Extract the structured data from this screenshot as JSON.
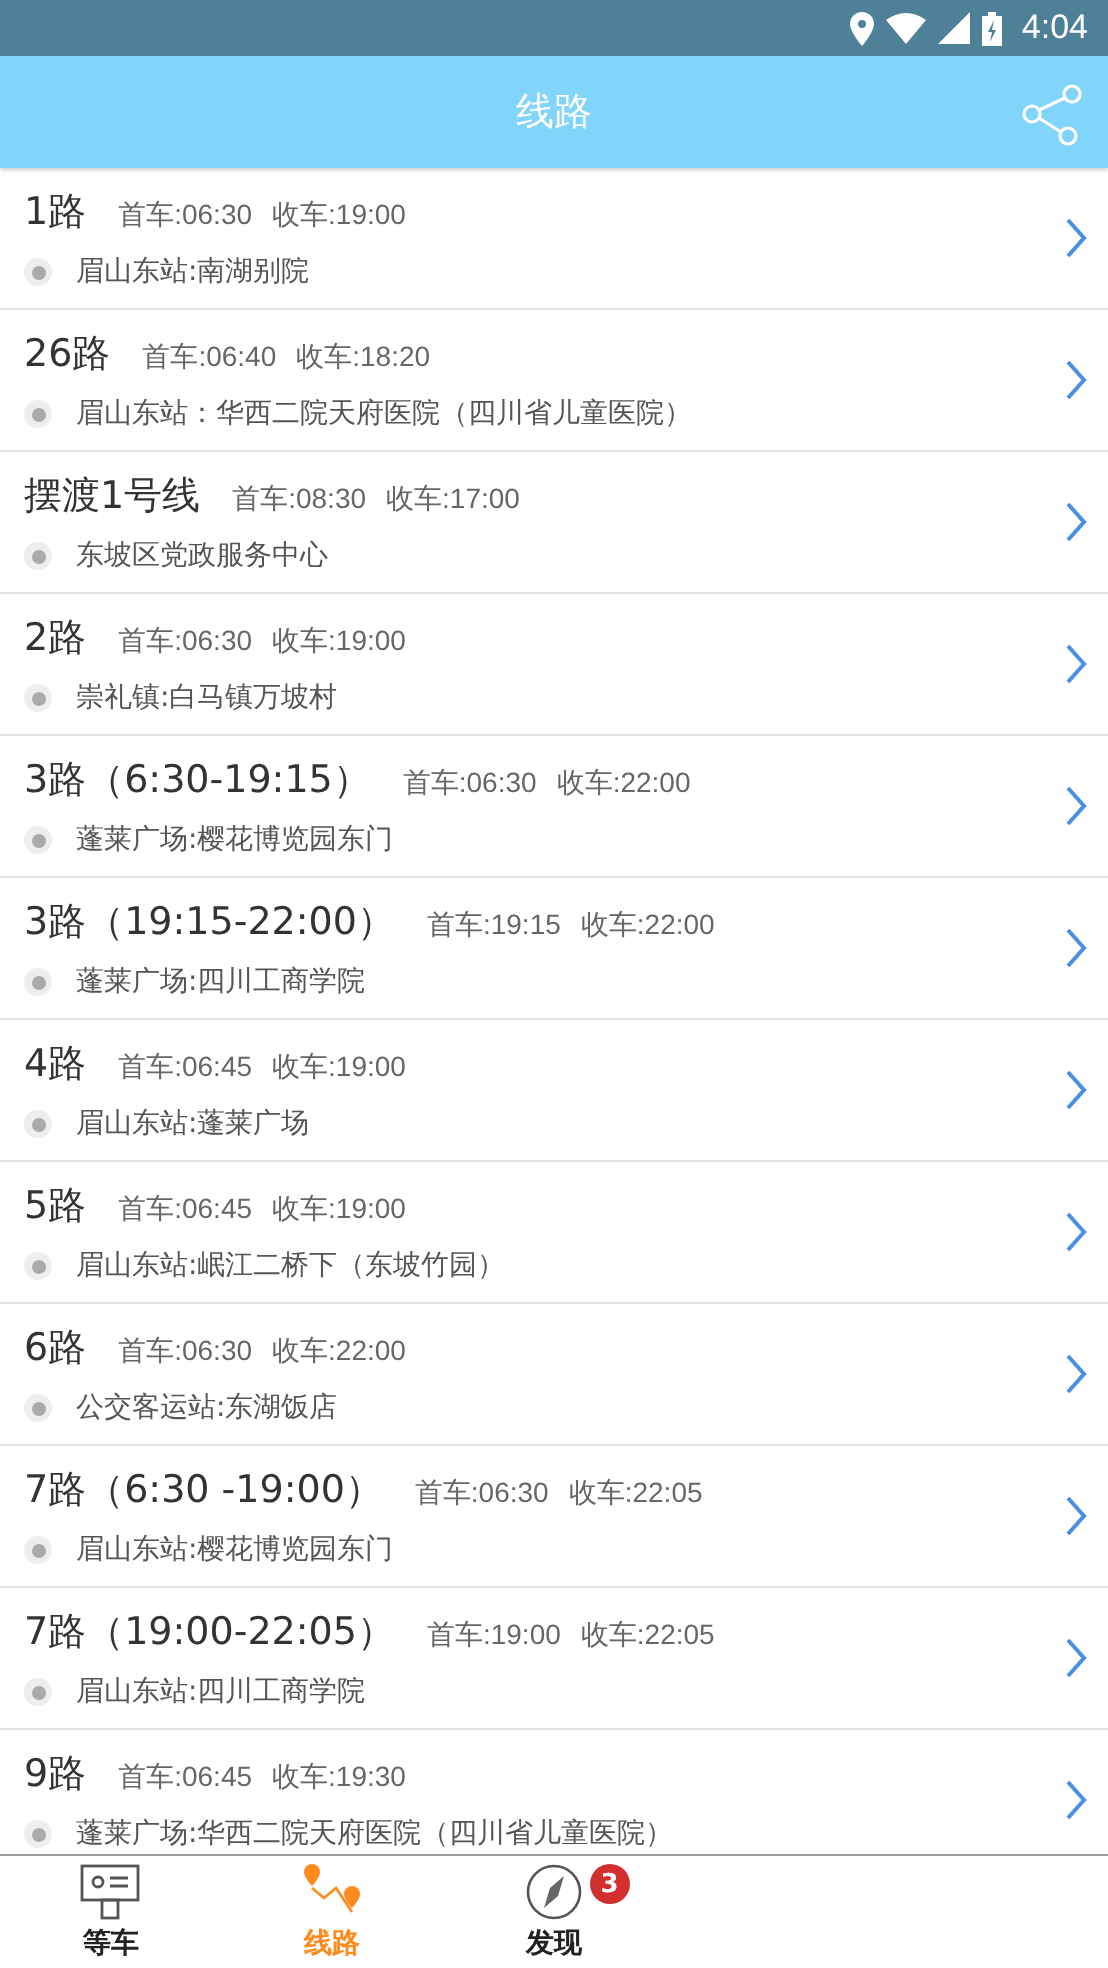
{
  "status_bar": {
    "time": "4:04"
  },
  "app_bar": {
    "title": "线路"
  },
  "routes": [
    {
      "name": "1路",
      "first": "首车:06:30",
      "last": "收车:19:00",
      "station": "眉山东站:南湖别院"
    },
    {
      "name": "26路",
      "first": "首车:06:40",
      "last": "收车:18:20",
      "station": "眉山东站：华西二院天府医院（四川省儿童医院）"
    },
    {
      "name": "摆渡1号线",
      "first": "首车:08:30",
      "last": "收车:17:00",
      "station": "东坡区党政服务中心"
    },
    {
      "name": "2路",
      "first": "首车:06:30",
      "last": "收车:19:00",
      "station": "崇礼镇:白马镇万坡村"
    },
    {
      "name": "3路（6:30-19:15）",
      "first": "首车:06:30",
      "last": "收车:22:00",
      "station": "蓬莱广场:樱花博览园东门"
    },
    {
      "name": "3路（19:15-22:00）",
      "first": "首车:19:15",
      "last": "收车:22:00",
      "station": "蓬莱广场:四川工商学院"
    },
    {
      "name": "4路",
      "first": "首车:06:45",
      "last": "收车:19:00",
      "station": "眉山东站:蓬莱广场"
    },
    {
      "name": "5路",
      "first": "首车:06:45",
      "last": "收车:19:00",
      "station": "眉山东站:岷江二桥下（东坡竹园）"
    },
    {
      "name": "6路",
      "first": "首车:06:30",
      "last": "收车:22:00",
      "station": "公交客运站:东湖饭店"
    },
    {
      "name": "7路（6:30 -19:00）",
      "first": "首车:06:30",
      "last": "收车:22:05",
      "station": "眉山东站:樱花博览园东门"
    },
    {
      "name": "7路（19:00-22:05）",
      "first": "首车:19:00",
      "last": "收车:22:05",
      "station": "眉山东站:四川工商学院"
    },
    {
      "name": "9路",
      "first": "首车:06:45",
      "last": "收车:19:30",
      "station": "蓬莱广场:华西二院天府医院（四川省儿童医院）"
    }
  ],
  "tabs": [
    {
      "kind": "board",
      "label": "等车",
      "selected": false
    },
    {
      "kind": "route",
      "label": "线路",
      "selected": true
    },
    {
      "kind": "compass",
      "label": "发现",
      "selected": false,
      "badge": "3"
    }
  ]
}
